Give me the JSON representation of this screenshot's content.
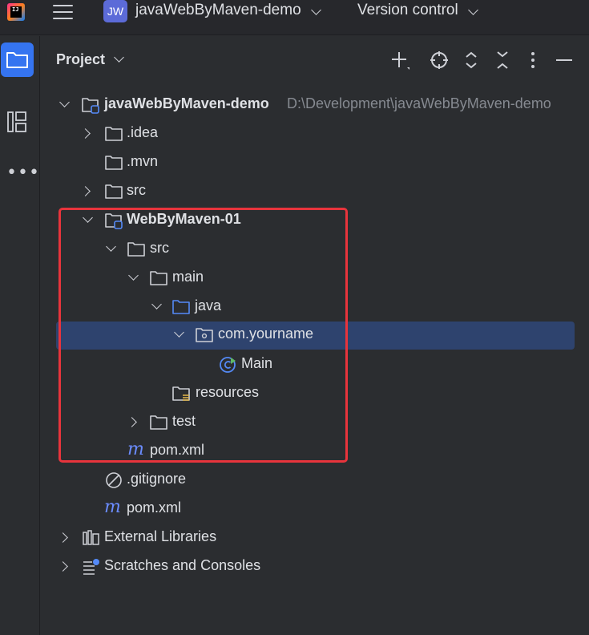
{
  "titlebar": {
    "app_logo_text": "IJ",
    "project_badge": "JW",
    "project_name": "javaWebByMaven-demo",
    "vcs_label": "Version control"
  },
  "panel": {
    "title": "Project"
  },
  "tree": {
    "root_name": "javaWebByMaven-demo",
    "root_path": "D:\\Development\\javaWebByMaven-demo",
    "idea": ".idea",
    "mvn": ".mvn",
    "src": "src",
    "module_name": "WebByMaven-01",
    "module_src": "src",
    "main": "main",
    "java": "java",
    "package": "com.yourname",
    "main_class": "Main",
    "resources": "resources",
    "test": "test",
    "module_pom": "pom.xml",
    "gitignore": ".gitignore",
    "root_pom": "pom.xml",
    "external_libraries": "External Libraries",
    "scratches": "Scratches and Consoles"
  },
  "colors": {
    "accent": "#3574f0",
    "selection": "#2e436e",
    "highlight": "#e8343c",
    "maven": "#6b8cff"
  }
}
